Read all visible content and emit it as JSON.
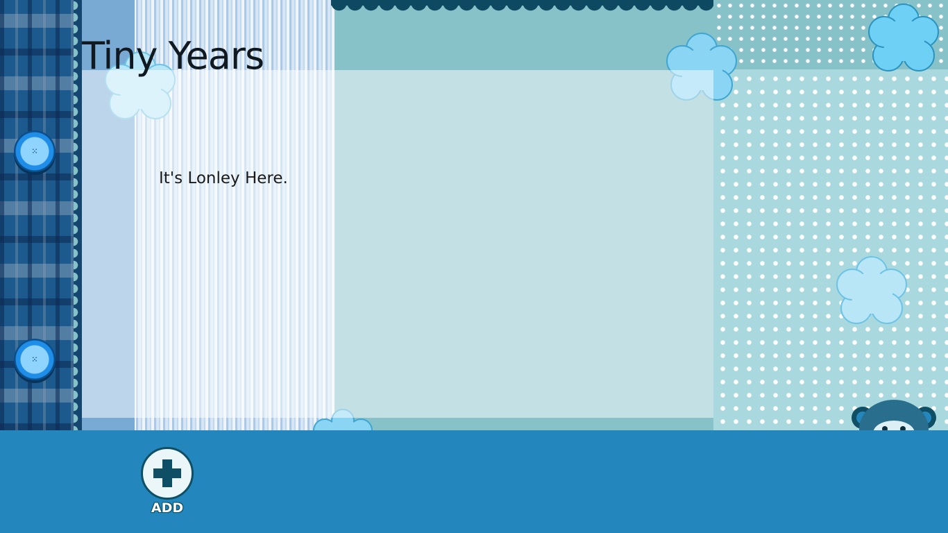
{
  "app": {
    "title": "Tiny Years"
  },
  "main": {
    "empty_message": "It's Lonley Here."
  },
  "app_bar": {
    "add_label": "ADD"
  },
  "colors": {
    "app_bar": "#2387bd",
    "teal_panel": "#86c2c8",
    "flower_fill": "#b8e6f7",
    "flower_stroke": "#4fb3d9",
    "button_blue": "#1e8ee8",
    "plaid_base": "#1c5a8e"
  },
  "icons": {
    "add": "plus-icon",
    "decor_buttons": "sewing-button-icon",
    "flowers": "flower-decoration",
    "mascot": "monkey-mascot"
  }
}
